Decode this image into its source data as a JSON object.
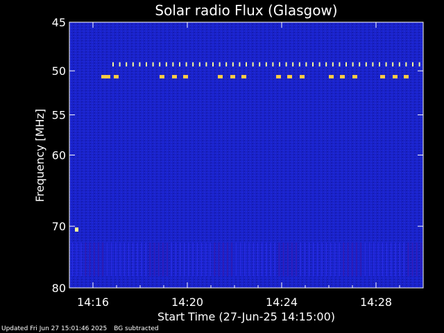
{
  "chart_data": {
    "type": "heatmap",
    "title": "Solar radio Flux (Glasgow)",
    "xlabel": "Start Time (27-Jun-25 14:15:00)",
    "ylabel": "Frequency [MHz]",
    "x_range": [
      "14:15:00",
      "14:30:00"
    ],
    "y_range_mhz": [
      45,
      80
    ],
    "y_scale": "log",
    "y_ticks": [
      45,
      50,
      55,
      60,
      70,
      80
    ],
    "x_ticks": [
      "14:16",
      "14:20",
      "14:24",
      "14:28"
    ],
    "colors": {
      "background": "#000000",
      "plot_bg": "#1a22c8",
      "burst_hot": "#ffff99",
      "burst_warm": "#ffcc44"
    },
    "features": [
      {
        "name": "periodic interference band upper",
        "freq_mhz": 49.3
      },
      {
        "name": "periodic interference band lower",
        "freq_mhz": 50.6
      },
      {
        "name": "broadband noise striations",
        "freq_mhz_range": [
          72.5,
          78
        ]
      }
    ]
  },
  "footer": {
    "updated": "Updated Fri Jun 27 15:01:46 2025",
    "note": "BG subtracted"
  }
}
